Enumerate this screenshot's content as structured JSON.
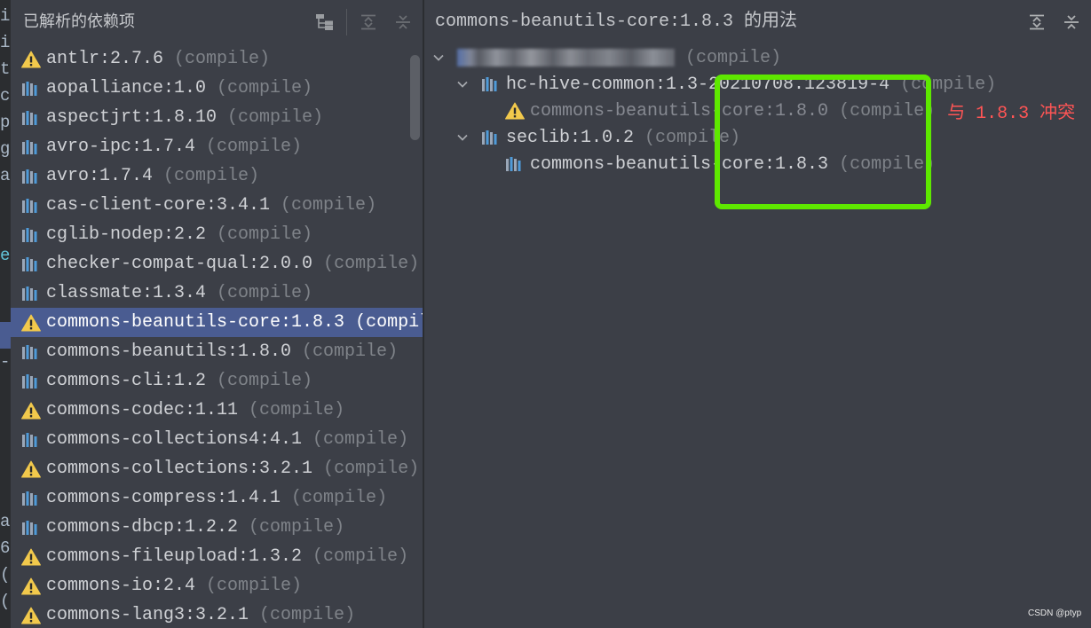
{
  "editor_strip": {
    "lines": [
      "i",
      "i",
      "t",
      "c",
      "p",
      "g",
      "a",
      "",
      "",
      "e",
      "",
      "",
      "",
      "-",
      "",
      "",
      "",
      "",
      "",
      "a",
      "6",
      "(",
      "("
    ]
  },
  "left_panel": {
    "title": "已解析的依赖项",
    "items": [
      {
        "name": "antlr:2.7.6",
        "scope": "(compile)",
        "icon": "warning-icon"
      },
      {
        "name": "aopalliance:1.0",
        "scope": "(compile)",
        "icon": "library-icon"
      },
      {
        "name": "aspectjrt:1.8.10",
        "scope": "(compile)",
        "icon": "library-icon"
      },
      {
        "name": "avro-ipc:1.7.4",
        "scope": "(compile)",
        "icon": "library-icon"
      },
      {
        "name": "avro:1.7.4",
        "scope": "(compile)",
        "icon": "library-icon"
      },
      {
        "name": "cas-client-core:3.4.1",
        "scope": "(compile)",
        "icon": "library-icon"
      },
      {
        "name": "cglib-nodep:2.2",
        "scope": "(compile)",
        "icon": "library-icon"
      },
      {
        "name": "checker-compat-qual:2.0.0",
        "scope": "(compile)",
        "icon": "library-icon"
      },
      {
        "name": "classmate:1.3.4",
        "scope": "(compile)",
        "icon": "library-icon"
      },
      {
        "name": "commons-beanutils-core:1.8.3",
        "scope": "(compile)",
        "icon": "warning-icon",
        "selected": true
      },
      {
        "name": "commons-beanutils:1.8.0",
        "scope": "(compile)",
        "icon": "library-icon"
      },
      {
        "name": "commons-cli:1.2",
        "scope": "(compile)",
        "icon": "library-icon"
      },
      {
        "name": "commons-codec:1.11",
        "scope": "(compile)",
        "icon": "warning-icon"
      },
      {
        "name": "commons-collections4:4.1",
        "scope": "(compile)",
        "icon": "library-icon"
      },
      {
        "name": "commons-collections:3.2.1",
        "scope": "(compile)",
        "icon": "warning-icon"
      },
      {
        "name": "commons-compress:1.4.1",
        "scope": "(compile)",
        "icon": "library-icon"
      },
      {
        "name": "commons-dbcp:1.2.2",
        "scope": "(compile)",
        "icon": "library-icon"
      },
      {
        "name": "commons-fileupload:1.3.2",
        "scope": "(compile)",
        "icon": "warning-icon"
      },
      {
        "name": "commons-io:2.4",
        "scope": "(compile)",
        "icon": "warning-icon"
      },
      {
        "name": "commons-lang3:3.2.1",
        "scope": "(compile)",
        "icon": "warning-icon"
      }
    ]
  },
  "right_panel": {
    "title": "commons-beanutils-core:1.8.3 的用法",
    "tree": [
      {
        "level": 0,
        "expanded": true,
        "redacted": true,
        "scope": "(compile)"
      },
      {
        "level": 1,
        "expanded": true,
        "icon": "library-icon",
        "name": "hc-hive-common:1.3-20210708.123819-4",
        "scope": "(compile)"
      },
      {
        "level": 2,
        "icon": "warning-icon",
        "name": "commons-beanutils-core:1.8.0",
        "scope": "(compile)",
        "muted": true,
        "conflict": "与 1.8.3 冲突"
      },
      {
        "level": 1,
        "expanded": true,
        "icon": "library-icon",
        "name": "seclib:1.0.2",
        "scope": "(compile)"
      },
      {
        "level": 2,
        "icon": "library-icon",
        "name": "commons-beanutils-core:1.8.3",
        "scope": "(compile)"
      }
    ]
  },
  "watermark": "CSDN @ptyp",
  "colors": {
    "panel_bg": "#3c3f47",
    "selection": "#4a5c91",
    "warning": "#f2c94c",
    "conflict": "#ff5555",
    "highlight_box": "#5ee800"
  }
}
